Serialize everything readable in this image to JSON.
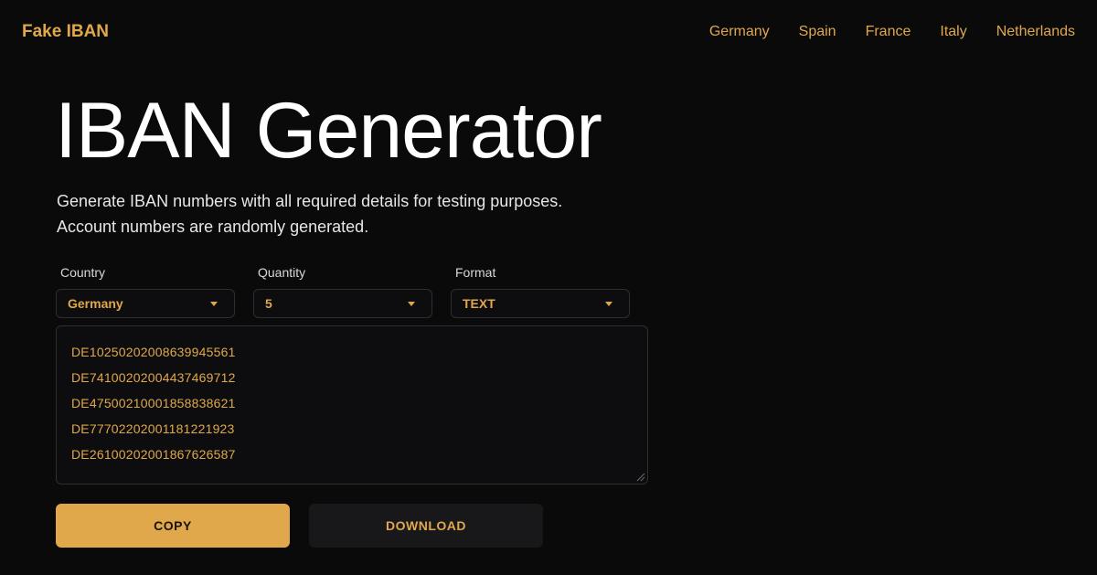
{
  "header": {
    "brand": "Fake IBAN",
    "nav": [
      "Germany",
      "Spain",
      "France",
      "Italy",
      "Netherlands"
    ]
  },
  "hero": {
    "title": "IBAN Generator",
    "subtitle_line1": "Generate IBAN numbers with all required details for testing purposes.",
    "subtitle_line2": "Account numbers are randomly generated."
  },
  "form": {
    "country": {
      "label": "Country",
      "value": "Germany"
    },
    "quantity": {
      "label": "Quantity",
      "value": "5"
    },
    "format": {
      "label": "Format",
      "value": "TEXT"
    }
  },
  "output": {
    "ibans": [
      "DE10250202008639945561",
      "DE74100202004437469712",
      "DE47500210001858838621",
      "DE77702202001181221923",
      "DE26100202001867626587"
    ]
  },
  "actions": {
    "copy_label": "COPY",
    "download_label": "DOWNLOAD"
  },
  "colors": {
    "accent": "#e0a84a",
    "background": "#0a0a0b"
  }
}
